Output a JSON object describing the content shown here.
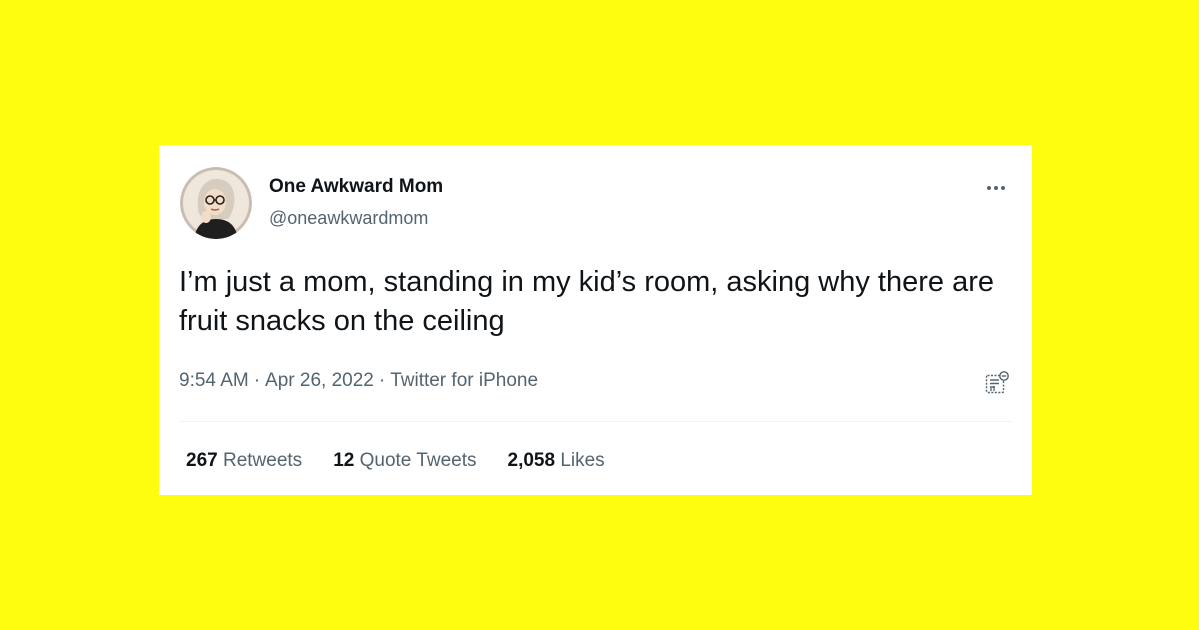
{
  "colors": {
    "background": "#FEFC0F",
    "card": "#ffffff",
    "primary_text": "#0f1419",
    "secondary_text": "#536471"
  },
  "tweet": {
    "author": {
      "display_name": "One Awkward Mom",
      "handle": "@oneawkwardmom",
      "avatar_icon": "user-avatar-photo"
    },
    "text": "I’m just a mom, standing in my kid’s room, asking why there are fruit snacks on the ceiling",
    "time": "9:54 AM",
    "separator": "·",
    "date": "Apr 26, 2022",
    "source": "Twitter for iPhone",
    "more_icon": "more-horizontal-icon",
    "analytics_icon": "analytics-icon",
    "stats": {
      "retweets_count": "267",
      "retweets_label": "Retweets",
      "quotes_count": "12",
      "quotes_label": "Quote Tweets",
      "likes_count": "2,058",
      "likes_label": "Likes"
    }
  }
}
